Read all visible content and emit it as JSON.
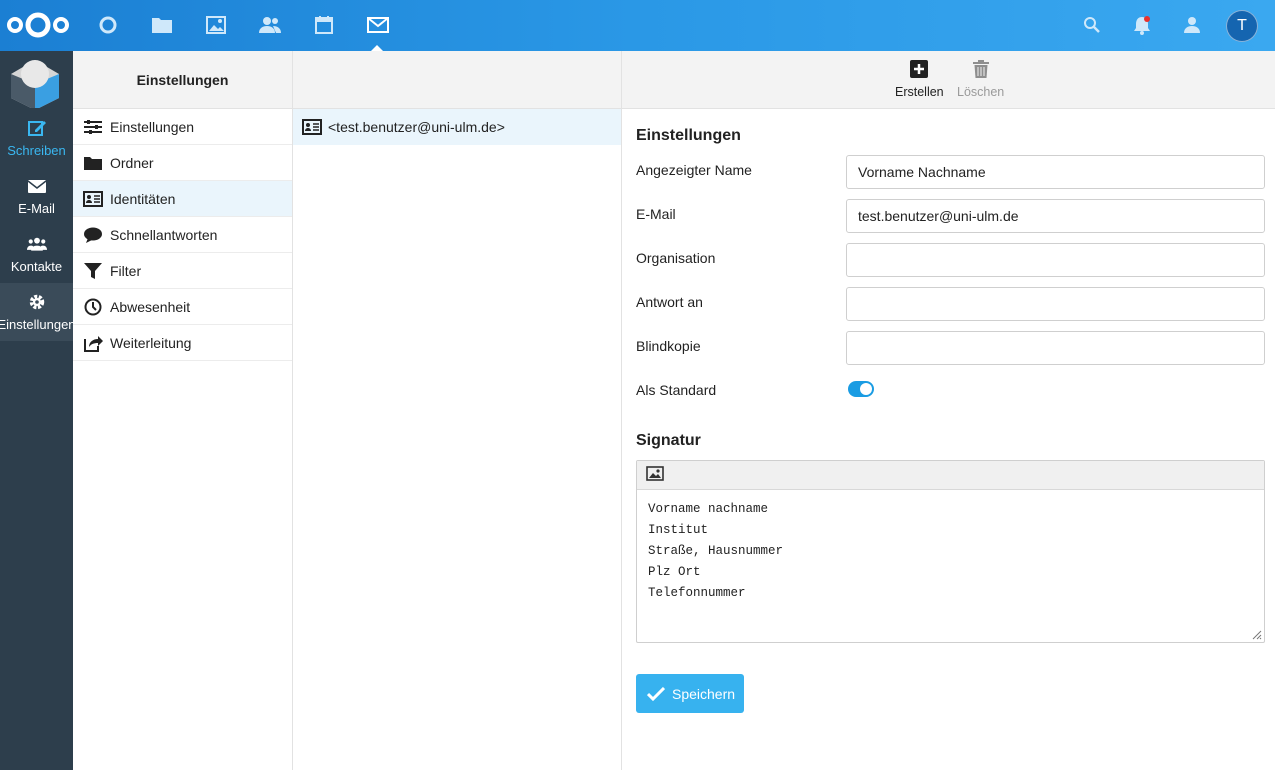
{
  "topbar": {
    "apps": [
      "dashboard-icon",
      "files-icon",
      "photos-icon",
      "contacts-icon",
      "calendar-icon",
      "mail-icon"
    ],
    "active_app": "mail-icon",
    "avatar_letter": "T",
    "accent_color": "#2a98e6"
  },
  "rail": {
    "items": [
      {
        "label": "Schreiben",
        "icon": "compose-icon"
      },
      {
        "label": "E-Mail",
        "icon": "envelope-icon"
      },
      {
        "label": "Kontakte",
        "icon": "contacts-icon"
      },
      {
        "label": "Einstellungen",
        "icon": "gear-icon"
      }
    ]
  },
  "nav": {
    "title": "Einstellungen",
    "items": [
      {
        "label": "Einstellungen",
        "icon": "sliders-icon"
      },
      {
        "label": "Ordner",
        "icon": "folder-icon"
      },
      {
        "label": "Identitäten",
        "icon": "id-card-icon"
      },
      {
        "label": "Schnellantworten",
        "icon": "speech-bubble-icon"
      },
      {
        "label": "Filter",
        "icon": "funnel-icon"
      },
      {
        "label": "Abwesenheit",
        "icon": "clock-icon"
      },
      {
        "label": "Weiterleitung",
        "icon": "forward-icon"
      }
    ],
    "selected": "Identitäten"
  },
  "list": {
    "rows": [
      {
        "label": "<test.benutzer@uni-ulm.de>",
        "icon": "id-card-icon"
      }
    ]
  },
  "toolbar": {
    "create_label": "Erstellen",
    "delete_label": "Löschen"
  },
  "form": {
    "section_title": "Einstellungen",
    "display_name": {
      "label": "Angezeigter Name",
      "value": "Vorname Nachname"
    },
    "email": {
      "label": "E-Mail",
      "value": "test.benutzer@uni-ulm.de"
    },
    "organisation": {
      "label": "Organisation",
      "value": ""
    },
    "reply_to": {
      "label": "Antwort an",
      "value": ""
    },
    "bcc": {
      "label": "Blindkopie",
      "value": ""
    },
    "default": {
      "label": "Als Standard",
      "enabled": true
    }
  },
  "signature": {
    "section_title": "Signatur",
    "text": "Vorname nachname\nInstitut\nStraße, Hausnummer\nPlz Ort\nTelefonnummer"
  },
  "save_label": "Speichern"
}
